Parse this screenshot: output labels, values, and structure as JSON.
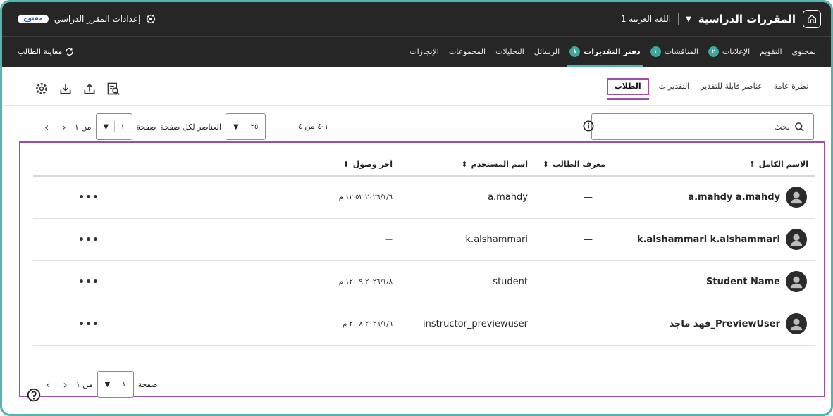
{
  "topbar": {
    "courses_label": "المقررات الدراسية",
    "language": "اللغة العربية 1",
    "settings_label": "إعدادات المقرر الدراسي",
    "status_pill": "مفتوح"
  },
  "nav": {
    "student_preview": "معاينة الطالب",
    "tabs": [
      {
        "label": "المحتوى",
        "badge": ""
      },
      {
        "label": "التقويم",
        "badge": ""
      },
      {
        "label": "الإعلانات",
        "badge": "٢"
      },
      {
        "label": "المناقشات",
        "badge": "١"
      },
      {
        "label": "دفتر التقديرات",
        "badge": "١",
        "active": true
      },
      {
        "label": "الرسائل",
        "badge": ""
      },
      {
        "label": "التحليلات",
        "badge": ""
      },
      {
        "label": "المجموعات",
        "badge": ""
      },
      {
        "label": "الإنجازات",
        "badge": ""
      }
    ]
  },
  "subtabs": [
    "نظرة عامة",
    "عناصر قابلة للتقدير",
    "التقديرات",
    "الطلاب"
  ],
  "search": {
    "placeholder": "بحث"
  },
  "pagination": {
    "count_label": "١-٤ من ٤",
    "per_page_value": "٢٥",
    "per_page_label": "العناصر لكل صفحة",
    "page_label": "صفحة",
    "page_value": "١",
    "of_label": "من ١"
  },
  "table": {
    "columns": {
      "full_name": "الاسم الكامل",
      "student_id": "معرف الطالب",
      "username": "اسم المستخدم",
      "last_access": "آخر وصول"
    },
    "rows": [
      {
        "name": "a.mahdy a.mahdy",
        "student_id": "—",
        "username": "a.mahdy",
        "last_access": "٢٠٢٦/١/٦ ١٢،٥٢ م"
      },
      {
        "name": "k.alshammari k.alshammari",
        "student_id": "—",
        "username": "k.alshammari",
        "last_access": "—"
      },
      {
        "name": "Student Name",
        "student_id": "—",
        "username": "student",
        "last_access": "٢٠٢٦/١/٨ ١٢،٠٩ م"
      },
      {
        "name": "فهد ماجد_PreviewUser",
        "student_id": "—",
        "username": "instructor_previewuser",
        "last_access": "٢٠٢٦/١/٦ ٢،٠٨ م"
      }
    ],
    "more_label": "•••"
  },
  "colors": {
    "accent": "#4fb7b0",
    "highlight": "#9b4fa8",
    "dark": "#262626"
  }
}
